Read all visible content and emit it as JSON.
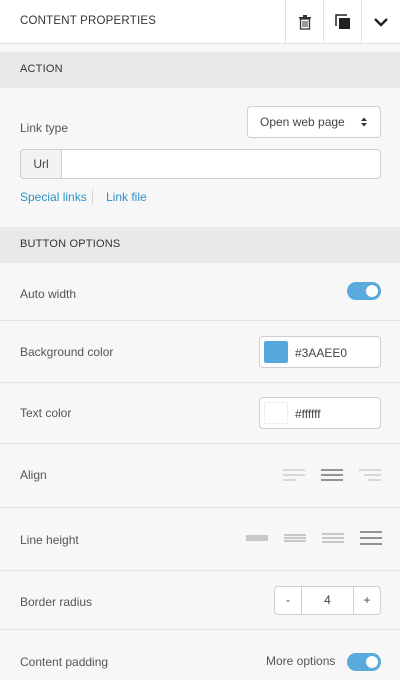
{
  "header": {
    "title": "CONTENT PROPERTIES"
  },
  "sections": {
    "action": "ACTION",
    "button_options": "BUTTON OPTIONS"
  },
  "action": {
    "link_type_label": "Link type",
    "link_type_value": "Open web page",
    "url_prefix": "Url",
    "url_value": "",
    "special_links": "Special links",
    "link_file": "Link file"
  },
  "options": {
    "auto_width_label": "Auto width",
    "auto_width_on": true,
    "bg_color_label": "Background color",
    "bg_color_value": "#3AAEE0",
    "text_color_label": "Text color",
    "text_color_value": "#ffffff",
    "align_label": "Align",
    "line_height_label": "Line height",
    "border_radius_label": "Border radius",
    "border_radius_minus": "-",
    "border_radius_value": "4",
    "border_radius_plus": "+",
    "content_padding_label": "Content padding",
    "more_options_label": "More options",
    "more_options_on": true
  },
  "colors": {
    "accent": "#5aa9dc",
    "link": "#2b91c8"
  }
}
